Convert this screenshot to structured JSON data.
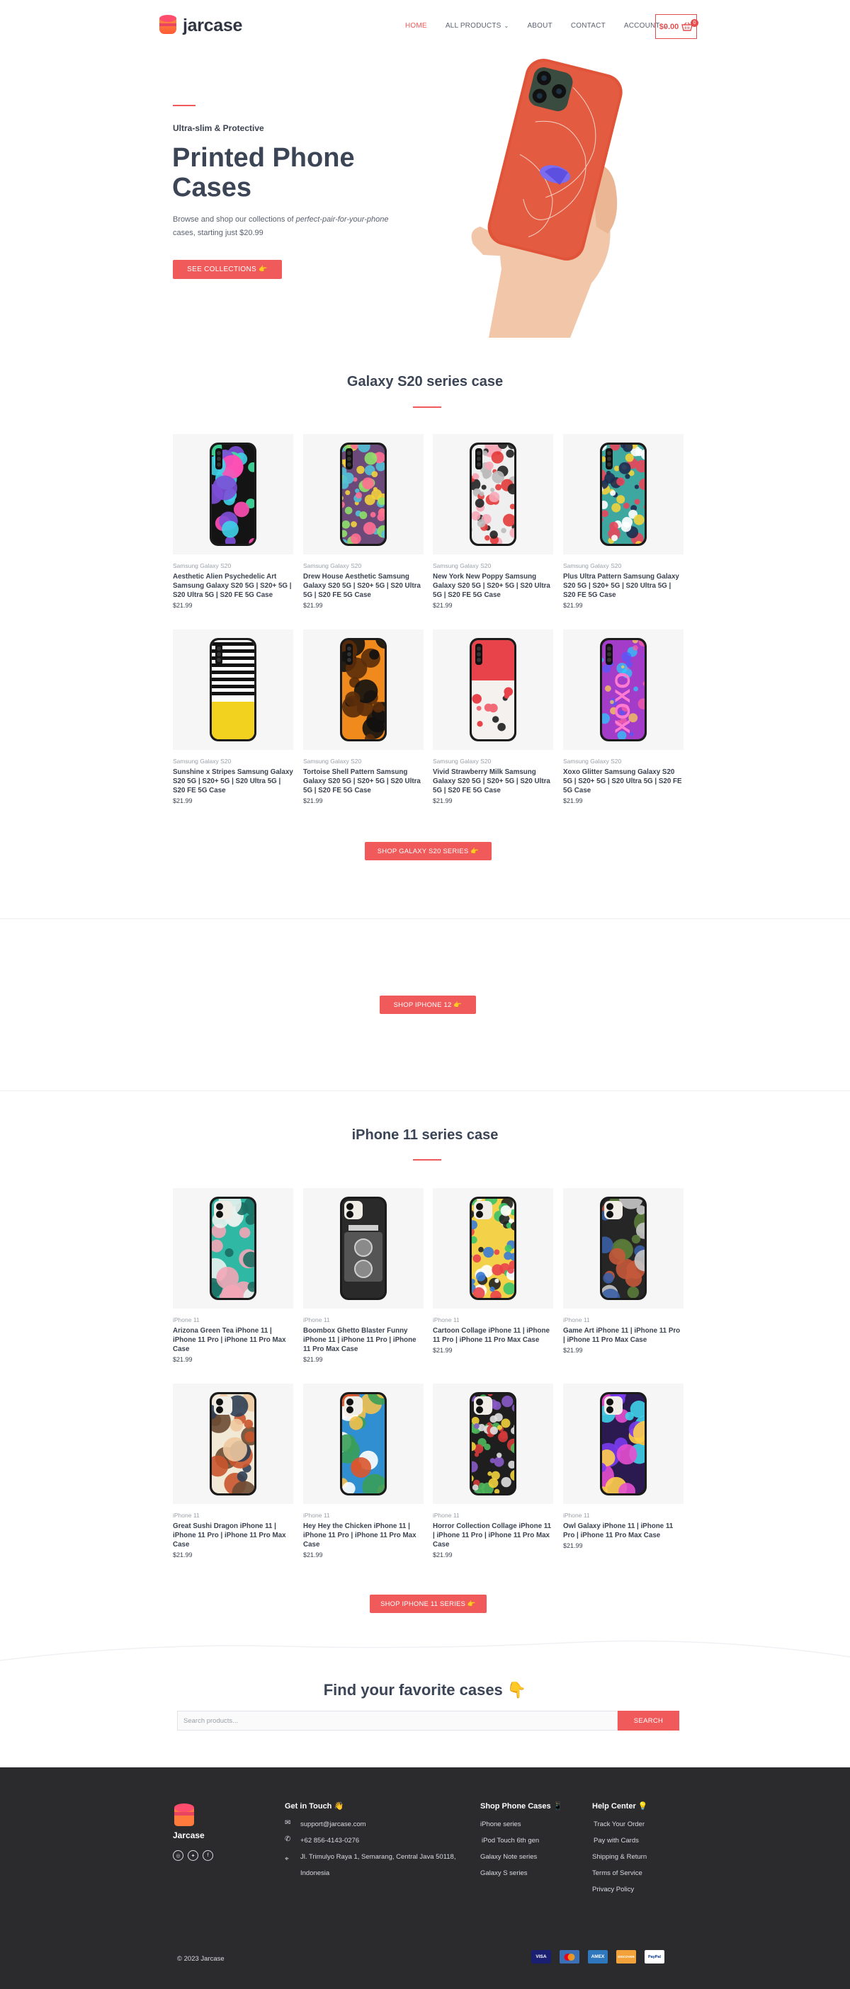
{
  "brand": {
    "name": "jarcase"
  },
  "nav": {
    "items": [
      {
        "label": "HOME",
        "active": true,
        "dropdown": false
      },
      {
        "label": "ALL PRODUCTS",
        "active": false,
        "dropdown": true
      },
      {
        "label": "ABOUT",
        "active": false,
        "dropdown": false
      },
      {
        "label": "CONTACT",
        "active": false,
        "dropdown": false
      },
      {
        "label": "ACCOUNT",
        "active": false,
        "dropdown": true
      }
    ],
    "cart_amount": "$0.00",
    "cart_count": "0"
  },
  "hero": {
    "kicker": "Ultra-slim & Protective",
    "title": "Printed Phone Cases",
    "desc_plain_1": "Browse and shop our collections of ",
    "desc_italic": "perfect-pair-for-your-phone",
    "desc_plain_2": " cases, starting just $20.99",
    "button_label": "SEE COLLECTIONS 👉"
  },
  "galaxy": {
    "title": "Galaxy S20 series case",
    "button_label": "SHOP GALAXY S20 SERIES 👉",
    "products": [
      {
        "category": "Samsung Galaxy S20",
        "title": "Aesthetic Alien Psychedelic Art Samsung Galaxy S20 5G | S20+ 5G | S20 Ultra 5G | S20 FE 5G Case",
        "price": "$21.99"
      },
      {
        "category": "Samsung Galaxy S20",
        "title": "Drew House Aesthetic Samsung Galaxy S20 5G | S20+ 5G | S20 Ultra 5G | S20 FE 5G Case",
        "price": "$21.99"
      },
      {
        "category": "Samsung Galaxy S20",
        "title": "New York New Poppy Samsung Galaxy S20 5G | S20+ 5G | S20 Ultra 5G | S20 FE 5G Case",
        "price": "$21.99"
      },
      {
        "category": "Samsung Galaxy S20",
        "title": "Plus Ultra Pattern Samsung Galaxy S20 5G | S20+ 5G | S20 Ultra 5G | S20 FE 5G Case",
        "price": "$21.99"
      },
      {
        "category": "Samsung Galaxy S20",
        "title": "Sunshine x Stripes Samsung Galaxy S20 5G | S20+ 5G | S20 Ultra 5G | S20 FE 5G Case",
        "price": "$21.99"
      },
      {
        "category": "Samsung Galaxy S20",
        "title": "Tortoise Shell Pattern Samsung Galaxy S20 5G | S20+ 5G | S20 Ultra 5G | S20 FE 5G Case",
        "price": "$21.99"
      },
      {
        "category": "Samsung Galaxy S20",
        "title": "Vivid Strawberry Milk Samsung Galaxy S20 5G | S20+ 5G | S20 Ultra 5G | S20 FE 5G Case",
        "price": "$21.99"
      },
      {
        "category": "Samsung Galaxy S20",
        "title": "Xoxo Glitter Samsung Galaxy S20 5G | S20+ 5G | S20 Ultra 5G | S20 FE 5G Case",
        "price": "$21.99"
      }
    ]
  },
  "iphone12": {
    "button_label": "SHOP IPHONE 12 👉"
  },
  "iphone11": {
    "title": "iPhone 11 series case",
    "button_label": "SHOP IPHONE 11 SERIES 👉",
    "products": [
      {
        "category": "iPhone 11",
        "title": "Arizona Green Tea iPhone 11 | iPhone 11 Pro | iPhone 11 Pro Max Case",
        "price": "$21.99"
      },
      {
        "category": "iPhone 11",
        "title": "Boombox Ghetto Blaster Funny iPhone 11 | iPhone 11 Pro | iPhone 11 Pro Max Case",
        "price": "$21.99"
      },
      {
        "category": "iPhone 11",
        "title": "Cartoon Collage iPhone 11 | iPhone 11 Pro | iPhone 11 Pro Max Case",
        "price": "$21.99"
      },
      {
        "category": "iPhone 11",
        "title": "Game Art iPhone 11 | iPhone 11 Pro | iPhone 11 Pro Max Case",
        "price": "$21.99"
      },
      {
        "category": "iPhone 11",
        "title": "Great Sushi Dragon iPhone 11 | iPhone 11 Pro | iPhone 11 Pro Max Case",
        "price": "$21.99"
      },
      {
        "category": "iPhone 11",
        "title": "Hey Hey the Chicken iPhone 11 | iPhone 11 Pro | iPhone 11 Pro Max Case",
        "price": "$21.99"
      },
      {
        "category": "iPhone 11",
        "title": "Horror Collection Collage iPhone 11 | iPhone 11 Pro | iPhone 11 Pro Max Case",
        "price": "$21.99"
      },
      {
        "category": "iPhone 11",
        "title": "Owl Galaxy iPhone 11 | iPhone 11 Pro | iPhone 11 Pro Max Case",
        "price": "$21.99"
      }
    ]
  },
  "search": {
    "title": "Find your favorite cases 👇",
    "placeholder": "Search products...",
    "button_label": "SEARCH"
  },
  "footer": {
    "brand": "Jarcase",
    "contact": {
      "heading": "Get in Touch 👋",
      "email": "support@jarcase.com",
      "phone": "+62 856-4143-0276",
      "address_1": "Jl. Trimulyo Raya 1, Semarang, Central Java 50118,",
      "address_2": "Indonesia"
    },
    "shop": {
      "heading": "Shop Phone Cases 📱",
      "links": [
        "iPhone series",
        "iPod Touch 6th gen",
        "Galaxy Note series",
        "Galaxy S series"
      ]
    },
    "help": {
      "heading": "Help Center 💡",
      "links": [
        "Track Your Order",
        "Pay with Cards",
        "Shipping & Return",
        "Terms of Service",
        "Privacy Policy"
      ]
    },
    "copyright": "© 2023 Jarcase",
    "payments": [
      "VISA",
      "MC",
      "AMEX",
      "DISCOVER",
      "PayPal"
    ]
  },
  "colors": {
    "accent": "#f05a5a",
    "footer_bg": "#2b2b2d",
    "heading": "#3b4556"
  }
}
